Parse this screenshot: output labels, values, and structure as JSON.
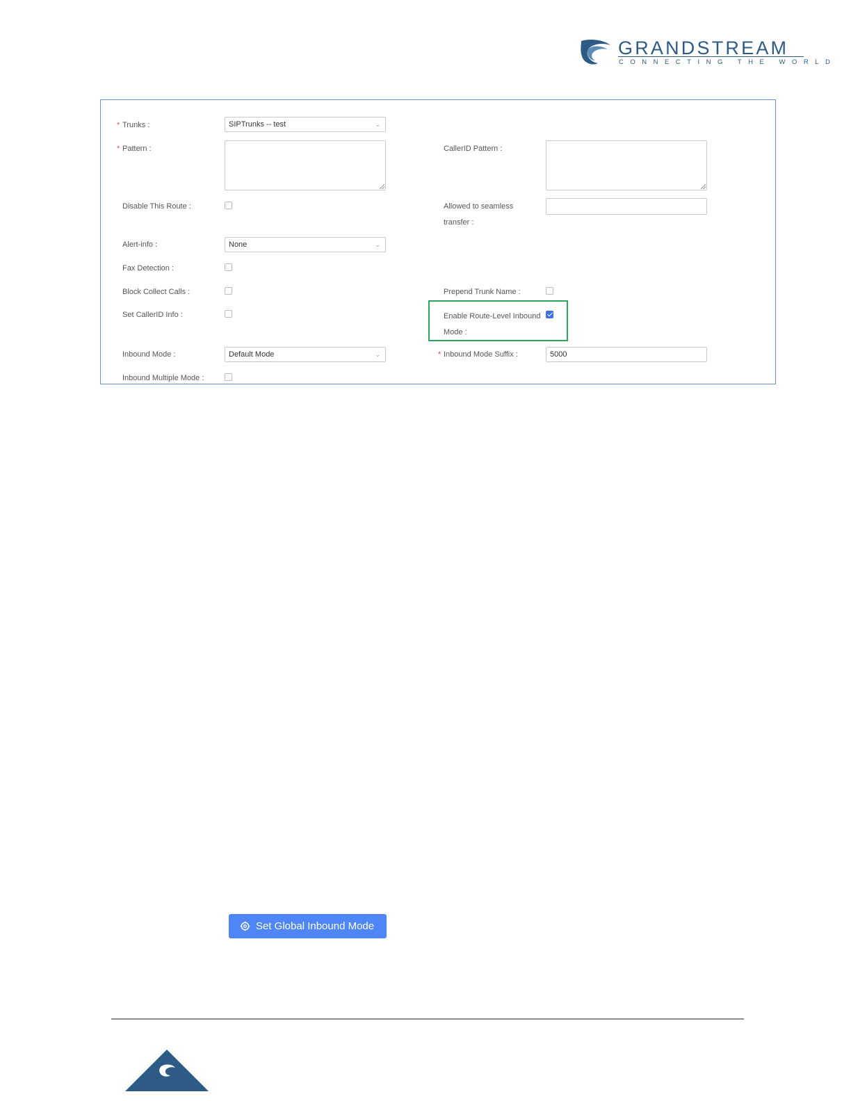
{
  "logo": {
    "brand": "GRANDSTREAM",
    "tagline": "CONNECTING THE WORLD"
  },
  "form": {
    "trunks": {
      "label": "Trunks :",
      "value": "SIPTrunks -- test"
    },
    "pattern": {
      "label": "Pattern :"
    },
    "callerid_pattern": {
      "label": "CallerID Pattern :"
    },
    "disable_route": {
      "label": "Disable This Route :",
      "checked": false
    },
    "seamless_transfer": {
      "label_line1": "Allowed to seamless",
      "label_line2": "transfer :"
    },
    "alert_info": {
      "label": "Alert-info :",
      "value": "None"
    },
    "fax_detection": {
      "label": "Fax Detection :",
      "checked": false
    },
    "block_collect_calls": {
      "label": "Block Collect Calls :",
      "checked": false
    },
    "prepend_trunk_name": {
      "label": "Prepend Trunk Name :",
      "checked": false
    },
    "set_callerid_info": {
      "label": "Set CallerID Info :",
      "checked": false
    },
    "enable_route_level": {
      "label_line1": "Enable Route-Level Inbound",
      "label_line2": "Mode :",
      "checked": true
    },
    "inbound_mode": {
      "label": "Inbound Mode :",
      "value": "Default Mode"
    },
    "inbound_mode_suffix": {
      "label": "Inbound Mode Suffix :",
      "value": "5000"
    },
    "inbound_multiple_mode": {
      "label": "Inbound Multiple Mode :",
      "checked": false
    },
    "required_mark": "*"
  },
  "button": {
    "label": "Set Global Inbound Mode",
    "icon": "gear-icon",
    "color": "#4f86f7"
  },
  "colors": {
    "frame_border": "#6b8fc9",
    "highlight": "#27a85a",
    "brand": "#2d5b86"
  }
}
